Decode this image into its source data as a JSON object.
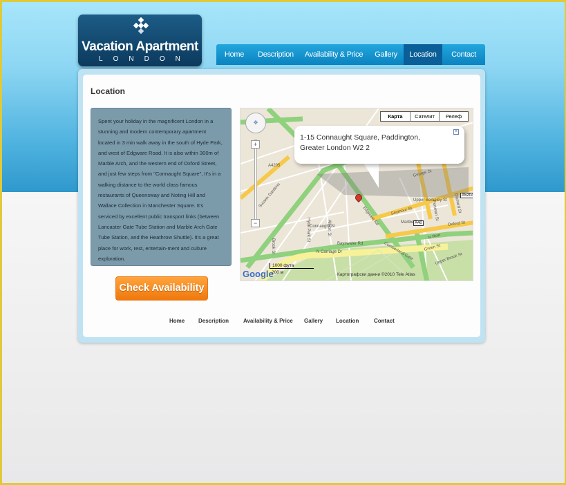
{
  "logo": {
    "title": "Vacation Apartment",
    "subtitle": "LONDON"
  },
  "nav": {
    "items": [
      {
        "label": "Home"
      },
      {
        "label": "Description"
      },
      {
        "label": "Availability & Price"
      },
      {
        "label": "Gallery"
      },
      {
        "label": "Location",
        "active": true
      },
      {
        "label": "Contact"
      }
    ]
  },
  "page": {
    "title": "Location",
    "description": "Spent your holiday in the magnificent London in a stunning and modern contemporary apartment located in 3 min walk away in the south of Hyde Park, and west of Edgware Road. It is also within 300m of Marble Arch, and the western end of Oxford Street, and just few steps from \"Connaught Square\", It's in a walking distance to the world class famous restaurants of Queensway and Noting Hill and Wallace Collection in Manchester Square. It's serviced by excellent public transport links (between Lancaster Gate Tube Station and Marble Arch Gate Tube Station, and the Heathrow Shuttle). It's a great place for work, rest, entertain-ment and culture exploration."
  },
  "map": {
    "types": [
      "Карта",
      "Сателит",
      "Релеф"
    ],
    "active_type": "Карта",
    "address": "1-15 Connaught Square, Paddington, Greater London W2 2",
    "logo": "Google",
    "scale_ft": "1000 фута",
    "scale_m": "200 м",
    "attribution": "Картографски данни ©2010 Tele Atlas",
    "labels": [
      "Edgware Rd",
      "A40",
      "A4205",
      "Sussex Gardens",
      "Connaught St",
      "Seymour St",
      "Upper Berkeley St",
      "Marble Arch",
      "Bayswater Rd",
      "N Carriage Dr",
      "Cumberland Gate",
      "Hyde Park St",
      "Albion St",
      "Brook St",
      "Portman St",
      "Orchard St",
      "Oxford St",
      "A5204",
      "Upper Brook St",
      "George St",
      "N Row",
      "Green St"
    ]
  },
  "button": {
    "label": "Check Availability"
  },
  "footer": {
    "links": [
      "Home",
      "Description",
      "Availability & Price",
      "Gallery",
      "Location",
      "Contact"
    ]
  },
  "colors": {
    "accent": "#0b83c0",
    "active_nav": "#0a5f98",
    "button": "#f0780c",
    "frame": "#e0c93a"
  }
}
